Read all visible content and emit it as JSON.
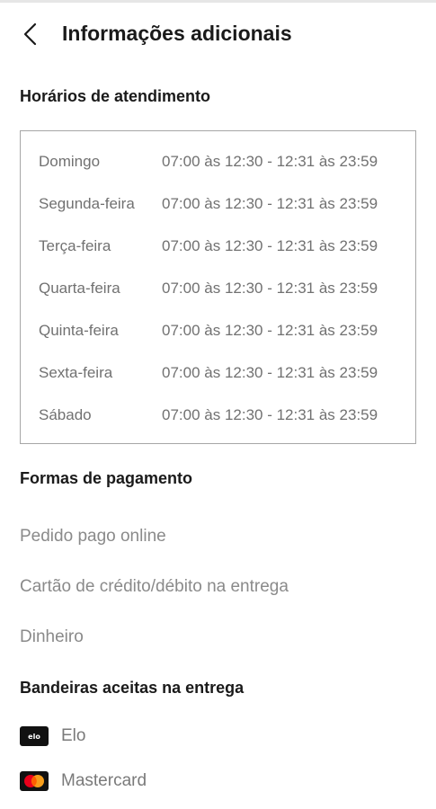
{
  "header": {
    "title": "Informações adicionais",
    "back_icon": "chevron-left-icon"
  },
  "hours": {
    "title": "Horários de atendimento",
    "rows": [
      {
        "day": "Domingo",
        "time": "07:00 às 12:30 - 12:31 às 23:59"
      },
      {
        "day": "Segunda-feira",
        "time": "07:00 às 12:30 - 12:31 às 23:59"
      },
      {
        "day": "Terça-feira",
        "time": "07:00 às 12:30 - 12:31 às 23:59"
      },
      {
        "day": "Quarta-feira",
        "time": "07:00 às 12:30 - 12:31 às 23:59"
      },
      {
        "day": "Quinta-feira",
        "time": "07:00 às 12:30 - 12:31 às 23:59"
      },
      {
        "day": "Sexta-feira",
        "time": "07:00 às 12:30 - 12:31 às 23:59"
      },
      {
        "day": "Sábado",
        "time": "07:00 às 12:30 - 12:31 às 23:59"
      }
    ]
  },
  "payment": {
    "title": "Formas de pagamento",
    "items": [
      "Pedido pago online",
      "Cartão de crédito/débito na entrega",
      "Dinheiro"
    ]
  },
  "brands": {
    "title": "Bandeiras aceitas na entrega",
    "items": [
      {
        "label": "Elo",
        "icon": "elo-logo-icon",
        "logo_text": "elo"
      },
      {
        "label": "Mastercard",
        "icon": "mastercard-logo-icon"
      }
    ]
  },
  "colors": {
    "mastercard_red": "#eb001b",
    "mastercard_orange": "#f79e1b",
    "mastercard_overlap": "#ff5f00"
  }
}
